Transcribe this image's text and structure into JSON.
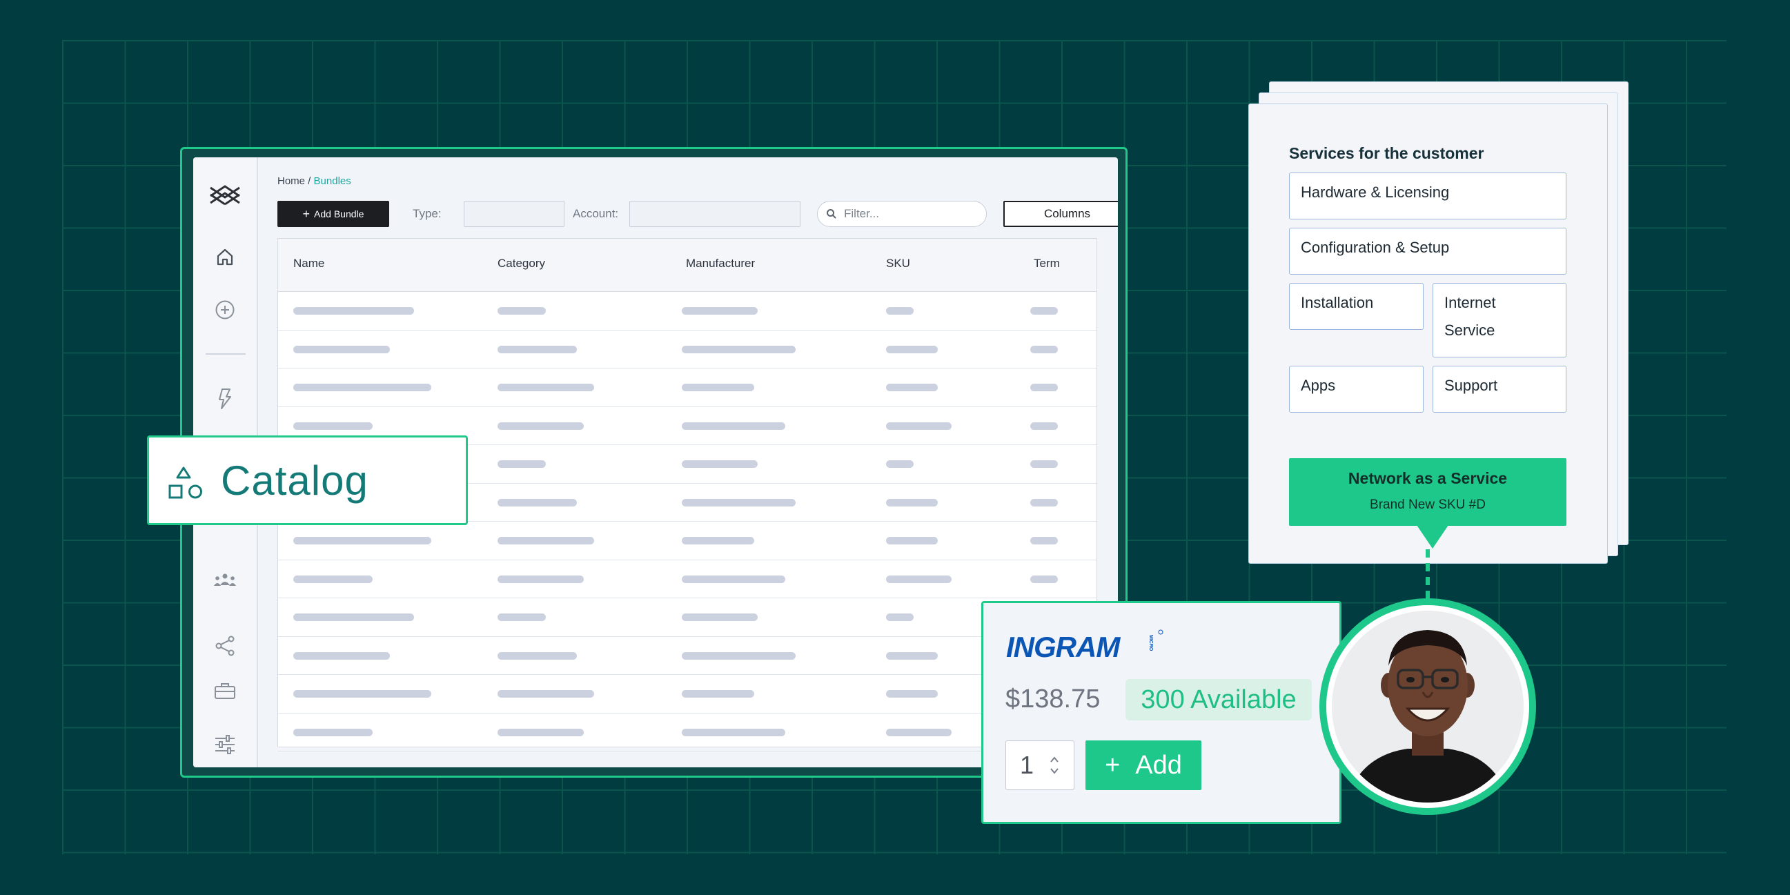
{
  "app": {
    "breadcrumb": {
      "home": "Home /",
      "current": "Bundles"
    },
    "toolbar": {
      "add_bundle": "Add Bundle",
      "type_label": "Type:",
      "account_label": "Account:",
      "filter_placeholder": "Filter...",
      "columns_label": "Columns"
    },
    "table": {
      "columns": [
        "Name",
        "Category",
        "Manufacturer",
        "SKU",
        "Term"
      ],
      "row_count": 12
    },
    "sidebar_icons": [
      "logo-icon",
      "home-icon",
      "add-circle-icon",
      "bolt-icon",
      "users-icon",
      "share-icon",
      "briefcase-icon",
      "sliders-icon"
    ]
  },
  "catalog": {
    "label": "Catalog",
    "icon": "shapes-icon"
  },
  "services": {
    "title": "Services for the customer",
    "items": [
      "Hardware & Licensing",
      "Configuration & Setup",
      "Installation",
      "Internet Service",
      "Apps",
      "Support"
    ],
    "highlight": {
      "title": "Network as a Service",
      "subtitle": "Brand New SKU #D"
    }
  },
  "product": {
    "vendor": "INGRAM MICRO",
    "price": "$138.75",
    "availability": "300 Available",
    "quantity": "1",
    "add_label": "Add"
  },
  "colors": {
    "background": "#013c40",
    "accent": "#1ec88a",
    "teal_text": "#147a77"
  }
}
